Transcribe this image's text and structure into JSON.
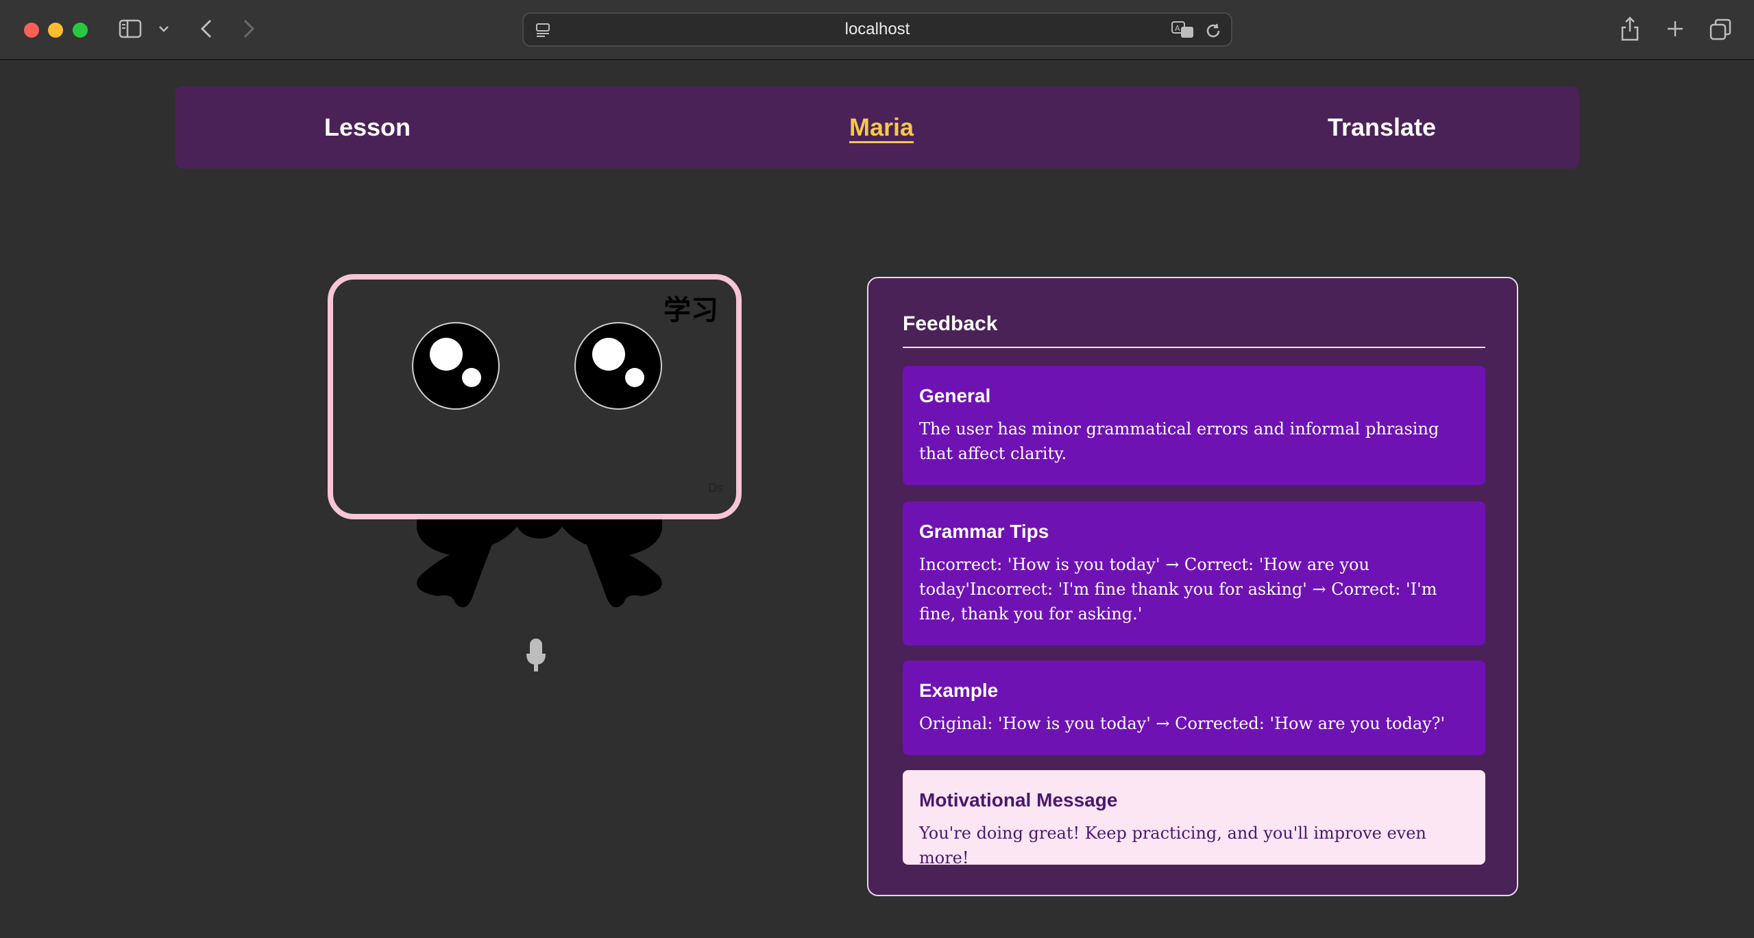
{
  "browser": {
    "url": "localhost"
  },
  "nav": {
    "items": [
      {
        "label": "Lesson"
      },
      {
        "label": "Maria"
      },
      {
        "label": "Translate"
      }
    ],
    "active_color": "#f5c84a"
  },
  "mascot": {
    "badge_text": "学习",
    "tag_text": "Ds"
  },
  "feedback": {
    "title": "Feedback",
    "general": {
      "heading": "General",
      "text": "The user has minor grammatical errors and informal phrasing that affect clarity."
    },
    "grammar": {
      "heading": "Grammar Tips",
      "text": "Incorrect: 'How is you today' → Correct: 'How are you today'Incorrect: 'I'm fine thank you for asking' → Correct: 'I'm fine, thank you for asking.'"
    },
    "example": {
      "heading": "Example",
      "text": "Original: 'How is you today' → Corrected: 'How are you today?'"
    },
    "motivation": {
      "heading": "Motivational Message",
      "text": "You're doing great! Keep practicing, and you'll improve even more!"
    }
  },
  "colors": {
    "nav_background": "#4b2257",
    "card_background": "#6f12b3",
    "motivation_background": "#fde6f4",
    "mascot_frame": "#f6c6d4"
  }
}
